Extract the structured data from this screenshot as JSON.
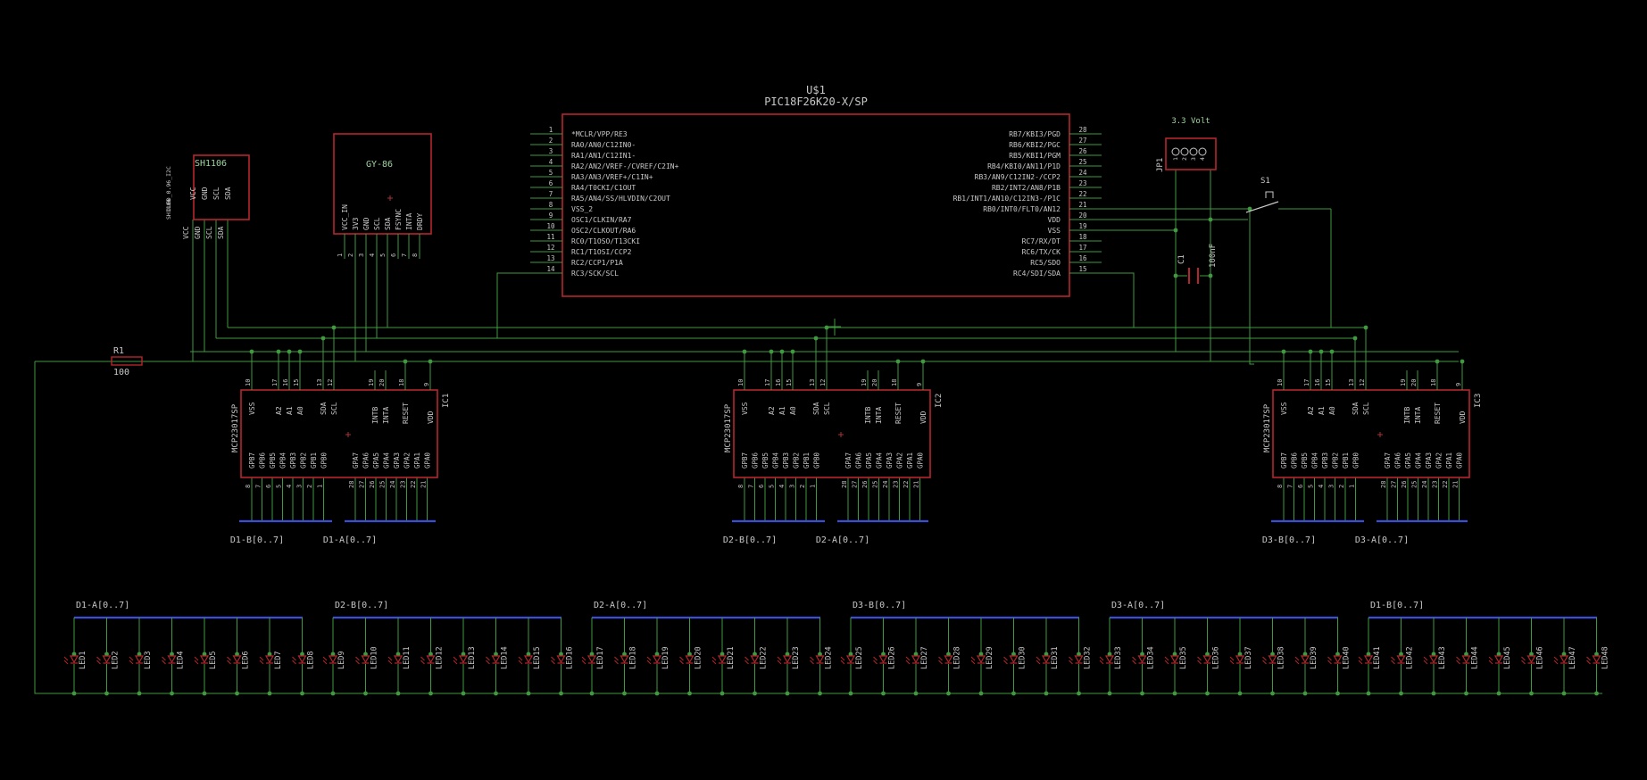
{
  "colors": {
    "background": "#000000",
    "part_outline": "#b4262c",
    "wire": "#3f9a3f",
    "bus": "#3a4fd6",
    "text": "#c8c8c8",
    "label": "#9fd59f",
    "junction": "#3f9a3f",
    "cross": "#a83232"
  },
  "mcu": {
    "name": "U$1",
    "value": "PIC18F26K20-X/SP",
    "pins_left": [
      {
        "num": "1",
        "name": "*MCLR/VPP/RE3"
      },
      {
        "num": "2",
        "name": "RA0/AN0/C12IN0-"
      },
      {
        "num": "3",
        "name": "RA1/AN1/C12IN1-"
      },
      {
        "num": "4",
        "name": "RA2/AN2/VREF-/CVREF/C2IN+"
      },
      {
        "num": "5",
        "name": "RA3/AN3/VREF+/C1IN+"
      },
      {
        "num": "6",
        "name": "RA4/T0CKI/C1OUT"
      },
      {
        "num": "7",
        "name": "RA5/AN4/SS/HLVDIN/C2OUT"
      },
      {
        "num": "8",
        "name": "VSS_2"
      },
      {
        "num": "9",
        "name": "OSC1/CLKIN/RA7"
      },
      {
        "num": "10",
        "name": "OSC2/CLKOUT/RA6"
      },
      {
        "num": "11",
        "name": "RC0/T1OSO/T13CKI"
      },
      {
        "num": "12",
        "name": "RC1/T1OSI/CCP2"
      },
      {
        "num": "13",
        "name": "RC2/CCP1/P1A"
      },
      {
        "num": "14",
        "name": "RC3/SCK/SCL"
      }
    ],
    "pins_right": [
      {
        "num": "28",
        "name": "RB7/KBI3/PGD"
      },
      {
        "num": "27",
        "name": "RB6/KBI2/PGC"
      },
      {
        "num": "26",
        "name": "RB5/KBI1/PGM"
      },
      {
        "num": "25",
        "name": "RB4/KBI0/AN11/P1D"
      },
      {
        "num": "24",
        "name": "RB3/AN9/C12IN2-/CCP2"
      },
      {
        "num": "23",
        "name": "RB2/INT2/AN8/P1B"
      },
      {
        "num": "22",
        "name": "RB1/INT1/AN10/C12IN3-/P1C"
      },
      {
        "num": "21",
        "name": "RB0/INT0/FLT0/AN12"
      },
      {
        "num": "20",
        "name": "VDD"
      },
      {
        "num": "19",
        "name": "VSS"
      },
      {
        "num": "18",
        "name": "RC7/RX/DT"
      },
      {
        "num": "17",
        "name": "RC6/TX/CK"
      },
      {
        "num": "16",
        "name": "RC5/SDO"
      },
      {
        "num": "15",
        "name": "RC4/SDI/SDA"
      }
    ]
  },
  "oled": {
    "name": "SH1106",
    "side_label": "OLED_0.96_I2C",
    "side_label2": "SH1106",
    "pins": [
      "VCC",
      "GND",
      "SCL",
      "SDA"
    ]
  },
  "gy86": {
    "name": "GY-86",
    "pins": [
      "VCC_IN",
      "3V3",
      "GND",
      "SCL",
      "SDA",
      "FSYNC",
      "INTA",
      "DRDY"
    ],
    "pin_numbers": [
      "1",
      "2",
      "3",
      "4",
      "5",
      "6",
      "7",
      "8"
    ]
  },
  "jp1": {
    "name": "JP1",
    "value": "3.3 Volt",
    "pin_numbers": [
      "1",
      "2",
      "3",
      "4"
    ]
  },
  "s1": {
    "name": "S1"
  },
  "c1": {
    "name": "C1",
    "value": "100nF"
  },
  "r1": {
    "name": "R1",
    "value": "100"
  },
  "expanders": [
    {
      "name": "IC1",
      "value": "MCP23017SP",
      "bus_b": "D1-B[0..7]",
      "bus_a": "D1-A[0..7]"
    },
    {
      "name": "IC2",
      "value": "MCP23017SP",
      "bus_b": "D2-B[0..7]",
      "bus_a": "D2-A[0..7]"
    },
    {
      "name": "IC3",
      "value": "MCP23017SP",
      "bus_b": "D3-B[0..7]",
      "bus_a": "D3-A[0..7]"
    }
  ],
  "expander_pins": {
    "top_left": [
      "VSS",
      "A2",
      "A1",
      "A0",
      "SDA",
      "SCL"
    ],
    "top_left_nums": [
      "10",
      "17",
      "16",
      "15",
      "13",
      "12"
    ],
    "top_right": [
      "INTB",
      "INTA",
      "RESET",
      "VDD"
    ],
    "top_right_nums": [
      "19",
      "20",
      "18",
      "9"
    ],
    "bottom_left": [
      "GPB7",
      "GPB6",
      "GPB5",
      "GPB4",
      "GPB3",
      "GPB2",
      "GPB1",
      "GPB0"
    ],
    "bottom_left_nums": [
      "8",
      "7",
      "6",
      "5",
      "4",
      "3",
      "2",
      "1"
    ],
    "bottom_right": [
      "GPA7",
      "GPA6",
      "GPA5",
      "GPA4",
      "GPA3",
      "GPA2",
      "GPA1",
      "GPA0"
    ],
    "bottom_right_nums": [
      "28",
      "27",
      "26",
      "25",
      "24",
      "23",
      "22",
      "21"
    ]
  },
  "led_banks": [
    {
      "bus": "D1-A[0..7]",
      "leds": [
        "LED1",
        "LED2",
        "LED3",
        "LED4",
        "LED5",
        "LED6",
        "LED7",
        "LED8"
      ]
    },
    {
      "bus": "D2-B[0..7]",
      "leds": [
        "LED9",
        "LED10",
        "LED11",
        "LED12",
        "LED13",
        "LED14",
        "LED15",
        "LED16"
      ]
    },
    {
      "bus": "D2-A[0..7]",
      "leds": [
        "LED17",
        "LED18",
        "LED19",
        "LED20",
        "LED21",
        "LED22",
        "LED23",
        "LED24"
      ]
    },
    {
      "bus": "D3-B[0..7]",
      "leds": [
        "LED25",
        "LED26",
        "LED27",
        "LED28",
        "LED29",
        "LED30",
        "LED31",
        "LED32"
      ]
    },
    {
      "bus": "D3-A[0..7]",
      "leds": [
        "LED33",
        "LED34",
        "LED35",
        "LED36",
        "LED37",
        "LED38",
        "LED39",
        "LED40"
      ]
    },
    {
      "bus": "D1-B[0..7]",
      "leds": [
        "LED41",
        "LED42",
        "LED43",
        "LED44",
        "LED45",
        "LED46",
        "LED47",
        "LED48"
      ]
    }
  ]
}
